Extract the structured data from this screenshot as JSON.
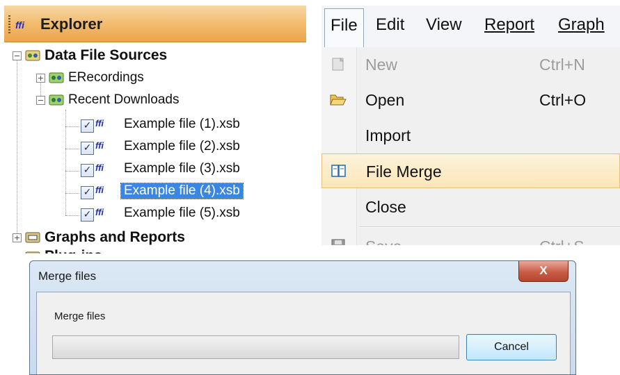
{
  "explorer": {
    "logo_text": "ffi",
    "title": "Explorer",
    "tree": {
      "data_file_sources": "Data File Sources",
      "erecordings": "ERecordings",
      "recent_downloads": "Recent Downloads",
      "files": [
        {
          "label": "Example file (1).xsb",
          "checked": true,
          "selected": false
        },
        {
          "label": "Example file (2).xsb",
          "checked": true,
          "selected": false
        },
        {
          "label": "Example file (3).xsb",
          "checked": true,
          "selected": false
        },
        {
          "label": "Example file (4).xsb",
          "checked": true,
          "selected": true
        },
        {
          "label": "Example file (5).xsb",
          "checked": true,
          "selected": false
        }
      ],
      "graphs_and_reports": "Graphs and Reports",
      "plugins_partial": "Plug-ins"
    },
    "expander_minus": "−",
    "expander_plus": "+",
    "check_mark": "✓"
  },
  "menu": {
    "menubar": [
      "File",
      "Edit",
      "View",
      "Report",
      "Graph"
    ],
    "items": {
      "new": {
        "label": "New",
        "shortcut": "Ctrl+N",
        "enabled": false
      },
      "open": {
        "label": "Open",
        "shortcut": "Ctrl+O",
        "enabled": true
      },
      "import": {
        "label": "Import"
      },
      "file_merge": {
        "label": "File Merge",
        "highlighted": true
      },
      "close": {
        "label": "Close"
      },
      "save": {
        "label": "Save",
        "shortcut": "Ctrl+S",
        "enabled": false
      }
    }
  },
  "dialog": {
    "title": "Merge files",
    "close_glyph": "X",
    "message": "Merge files",
    "progress_fraction": 0,
    "cancel_label": "Cancel"
  },
  "colors": {
    "header_orange": "#f2b96a",
    "selection_blue": "#3a86e6",
    "menu_highlight": "#fbe6b6",
    "close_red": "#c95c45"
  }
}
